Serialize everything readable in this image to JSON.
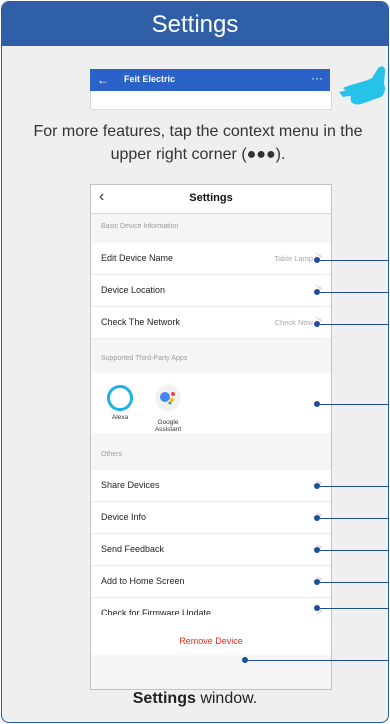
{
  "header": {
    "title": "Settings"
  },
  "app_bar": {
    "back_icon": "arrow-left-icon",
    "title": "Feit Electric",
    "more_label": "···"
  },
  "hint_text": "For more features, tap the context menu in the upper right corner (●●●).",
  "phone": {
    "title": "Settings",
    "back_icon": "chevron-left-icon",
    "sections": {
      "basic": "Basic Device Information",
      "third_party": "Supported Third-Party Apps",
      "others": "Others"
    },
    "rows": [
      {
        "label": "Edit Device Name",
        "value": "Table Lamp"
      },
      {
        "label": "Device Location",
        "value": ""
      },
      {
        "label": "Check The Network",
        "value": "Check Now"
      }
    ],
    "apps": [
      {
        "name": "Alexa",
        "icon": "alexa-icon",
        "color": "#1fb0e8"
      },
      {
        "name": "Google\nAssistant",
        "icon": "google-assistant-icon",
        "color": "#4285f4"
      }
    ],
    "other_rows": [
      {
        "label": "Share Devices"
      },
      {
        "label": "Device Info"
      },
      {
        "label": "Send Feedback"
      },
      {
        "label": "Add to Home Screen"
      },
      {
        "label": "Check for Firmware Update"
      }
    ],
    "remove_label": "Remove Device"
  },
  "caption": {
    "bold": "Settings",
    "rest": " window."
  },
  "colors": {
    "header": "#2f5fa7",
    "app_bar": "#2b62c7",
    "remove": "#e62d1e",
    "callout": "#1f4c9b"
  }
}
